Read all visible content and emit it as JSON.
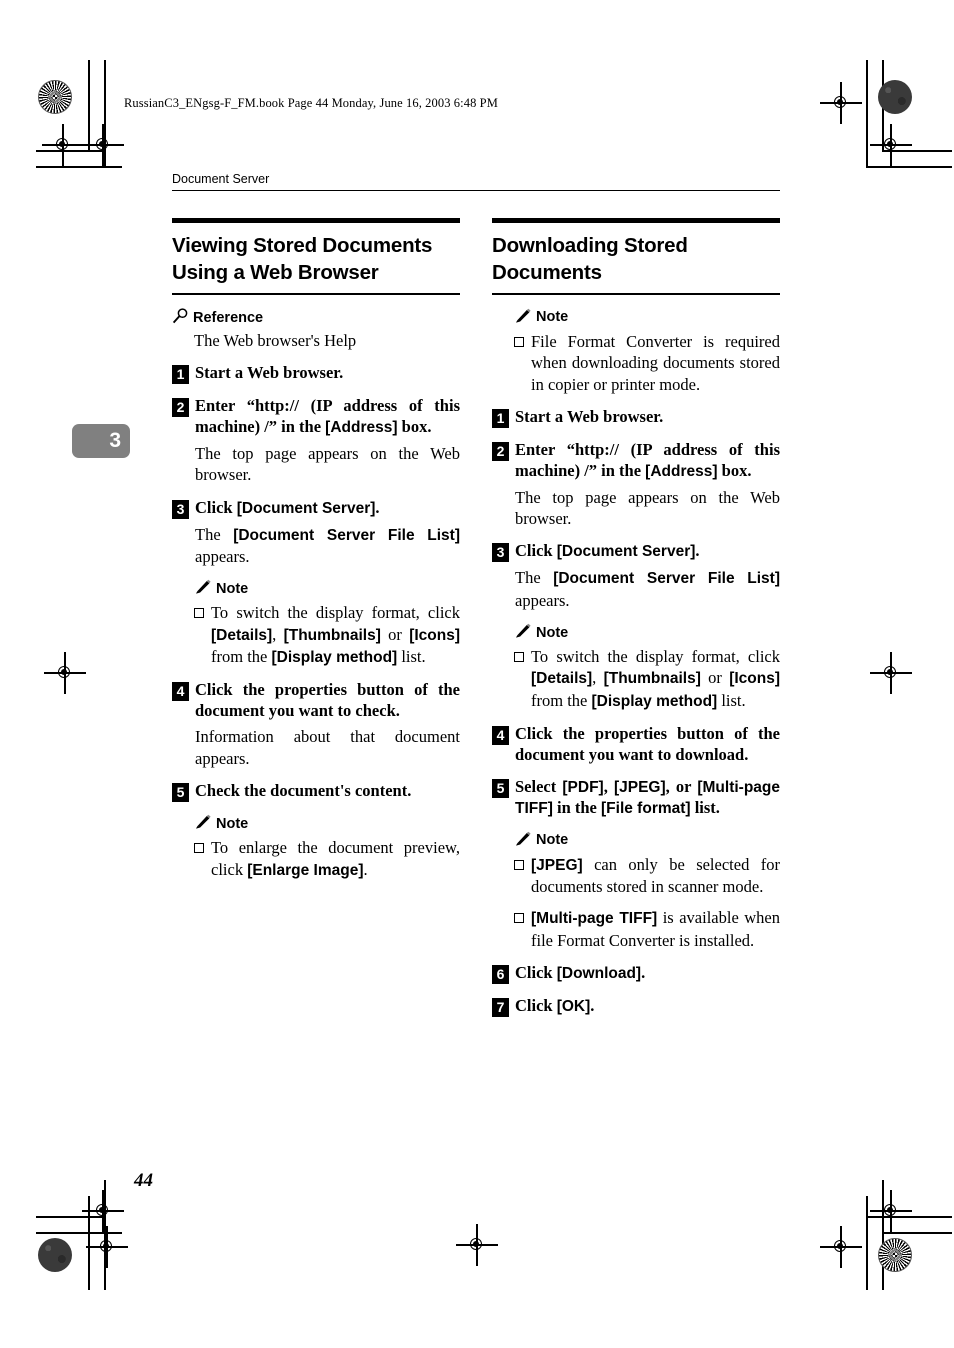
{
  "file_header": "RussianC3_ENgsg-F_FM.book  Page 44  Monday, June 16, 2003  6:48 PM",
  "running_head": "Document Server",
  "chapter_tab": "3",
  "folio": "44",
  "left_column": {
    "title": "Viewing Stored Documents Using a Web Browser",
    "reference": {
      "icon": "magnifier-icon",
      "label": "Reference",
      "body": "The Web browser's Help"
    },
    "steps": [
      {
        "num": "1",
        "text_html": "Start a Web browser."
      },
      {
        "num": "2",
        "text_html": "Enter “http:// (IP address of this machine) /” in the <span class=\"k\">[Address]</span> box.",
        "result_html": "The top page appears on the Web browser."
      },
      {
        "num": "3",
        "text_html": "Click <span class=\"k\">[Document Server]</span>.",
        "result_html": "The <span class=\"k\">[Document Server File List]</span> appears.",
        "note": {
          "icon": "pencil-icon",
          "label": "Note",
          "items": [
            "To switch the display format, click <span class=\"k\">[Details]</span>, <span class=\"k\">[Thumbnails]</span> or <span class=\"k\">[Icons]</span> from the <span class=\"k\">[Display method]</span> list."
          ]
        }
      },
      {
        "num": "4",
        "text_html": "Click the properties button of the document you want to check.",
        "result_html": "Information about that document appears."
      },
      {
        "num": "5",
        "text_html": "Check the document's content.",
        "note": {
          "icon": "pencil-icon",
          "label": "Note",
          "items": [
            "To enlarge the document preview, click <span class=\"k\">[Enlarge Image]</span>."
          ]
        }
      }
    ]
  },
  "right_column": {
    "title": "Downloading Stored Documents",
    "intro_note": {
      "icon": "pencil-icon",
      "label": "Note",
      "items": [
        "File Format Converter is required when downloading documents stored in copier or printer mode."
      ]
    },
    "steps": [
      {
        "num": "1",
        "text_html": "Start a Web browser."
      },
      {
        "num": "2",
        "text_html": "Enter “http:// (IP address of this machine) /” in the <span class=\"k\">[Address]</span> box.",
        "result_html": "The top page appears on the Web browser."
      },
      {
        "num": "3",
        "text_html": "Click <span class=\"k\">[Document Server]</span>.",
        "result_html": "The <span class=\"k\">[Document Server File List]</span> appears.",
        "note": {
          "icon": "pencil-icon",
          "label": "Note",
          "items": [
            "To switch the display format, click <span class=\"k\">[Details]</span>, <span class=\"k\">[Thumbnails]</span> or <span class=\"k\">[Icons]</span> from the <span class=\"k\">[Display method]</span> list."
          ]
        }
      },
      {
        "num": "4",
        "text_html": "Click the properties button of the document you want to download."
      },
      {
        "num": "5",
        "text_html": "Select <span class=\"k\">[PDF]</span>, <span class=\"k\">[JPEG]</span>, or <span class=\"k\">[Multi-page TIFF]</span> in the <span class=\"k\">[File format]</span> list.",
        "note": {
          "icon": "pencil-icon",
          "label": "Note",
          "items": [
            "<span class=\"k\">[JPEG]</span> can only be selected for documents stored in scanner mode.",
            "<span class=\"k\">[Multi-page TIFF]</span> is available when file Format Converter is installed."
          ]
        }
      },
      {
        "num": "6",
        "text_html": "Click <span class=\"k\">[Download]</span>."
      },
      {
        "num": "7",
        "text_html": "Click <span class=\"k\">[OK]</span>."
      }
    ]
  }
}
